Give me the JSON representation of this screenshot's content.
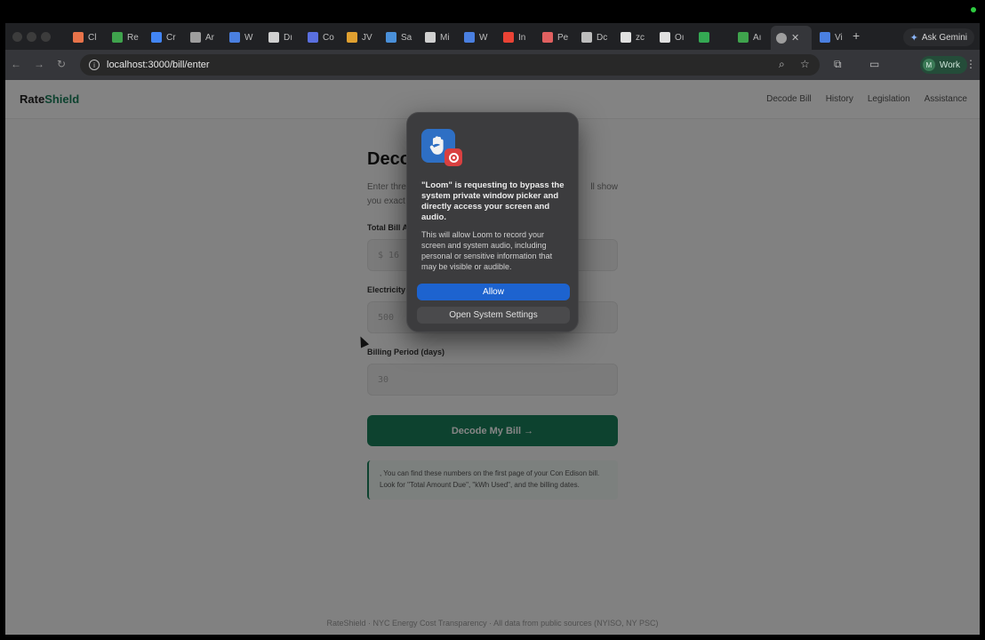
{
  "browser": {
    "tabs": [
      {
        "label": "Cl",
        "color": "#e8734a"
      },
      {
        "label": "Re",
        "color": "#3fa34d"
      },
      {
        "label": "Cr",
        "color": "#4285f4"
      },
      {
        "label": "Ar",
        "color": "#9e9e9e"
      },
      {
        "label": "W",
        "color": "#4a7fe0"
      },
      {
        "label": "Dı",
        "color": "#d0d0d0"
      },
      {
        "label": "Co",
        "color": "#5a6fe0"
      },
      {
        "label": "JV",
        "color": "#e0a030"
      },
      {
        "label": "Sa",
        "color": "#4a90d9"
      },
      {
        "label": "Mi",
        "color": "#d0d0d0"
      },
      {
        "label": "W",
        "color": "#4a7fe0"
      },
      {
        "label": "In",
        "color": "#ea4335"
      },
      {
        "label": "Pe",
        "color": "#e06060"
      },
      {
        "label": "Dc",
        "color": "#bdbdbd"
      },
      {
        "label": "zc",
        "color": "#e0e0e0"
      },
      {
        "label": "Oı",
        "color": "#e0e0e0"
      },
      {
        "label": "",
        "color": "#34a853"
      },
      {
        "label": "Aı",
        "color": "#3fa34d"
      },
      {
        "label": "",
        "color": "#9e9e9e"
      },
      {
        "label": "Vi",
        "color": "#4a7fe0"
      }
    ],
    "ask_gemini": "Ask Gemini",
    "url": "localhost:3000/bill/enter",
    "profile_initial": "M",
    "profile_label": "Work"
  },
  "site": {
    "logo_main": "Rate",
    "logo_accent": "Shield",
    "nav": [
      "Decode Bill",
      "History",
      "Legislation",
      "Assistance"
    ]
  },
  "form": {
    "title": "Deco",
    "subtitle_line1": "Enter thre",
    "subtitle_line1_end": "ll show",
    "subtitle_line2": "you exact",
    "total_label": "Total Bill A",
    "total_placeholder": "$ 16",
    "electricity_label": "Electricity",
    "electricity_placeholder": "500",
    "billing_label": "Billing Period (days)",
    "billing_placeholder": "30",
    "submit_label": "Decode My Bill →",
    "tip": ", You can find these numbers on the first page of your Con Edison bill. Look for \"Total Amount Due\", \"kWh Used\", and the billing dates."
  },
  "footer": "RateShield · NYC Energy Cost Transparency · All data from public sources (NYISO, NY PSC)",
  "dialog": {
    "title": "\"Loom\" is requesting to bypass the system private window picker and directly access your screen and audio.",
    "body": "This will allow Loom to record your screen and system audio, including personal or sensitive information that may be visible or audible.",
    "allow_label": "Allow",
    "settings_label": "Open System Settings"
  }
}
